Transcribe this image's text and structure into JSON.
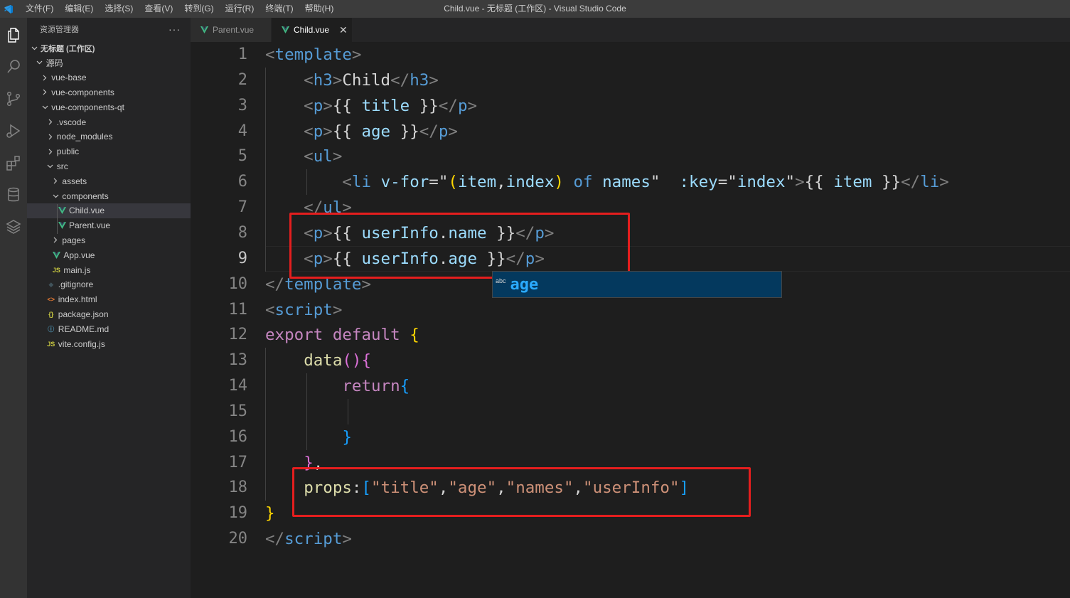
{
  "titlebar": {
    "menu": [
      "文件(F)",
      "编辑(E)",
      "选择(S)",
      "查看(V)",
      "转到(G)",
      "运行(R)",
      "终端(T)",
      "帮助(H)"
    ],
    "window_title": "Child.vue - 无标题 (工作区) - Visual Studio Code"
  },
  "activity_bar": [
    "explorer-icon",
    "search-icon",
    "source-control-icon",
    "run-debug-icon",
    "extensions-icon",
    "database-icon",
    "layers-icon"
  ],
  "sidebar": {
    "title": "资源管理器",
    "more": "···",
    "tree": [
      {
        "label": "无标题 (工作区)",
        "depth": 0,
        "type": "folder-open",
        "bold": true
      },
      {
        "label": "源码",
        "depth": 1,
        "type": "folder-open"
      },
      {
        "label": "vue-base",
        "depth": 2,
        "type": "folder"
      },
      {
        "label": "vue-components",
        "depth": 2,
        "type": "folder"
      },
      {
        "label": "vue-components-qt",
        "depth": 2,
        "type": "folder-open"
      },
      {
        "label": ".vscode",
        "depth": 3,
        "type": "folder"
      },
      {
        "label": "node_modules",
        "depth": 3,
        "type": "folder"
      },
      {
        "label": "public",
        "depth": 3,
        "type": "folder"
      },
      {
        "label": "src",
        "depth": 3,
        "type": "folder-open"
      },
      {
        "label": "assets",
        "depth": 4,
        "type": "folder"
      },
      {
        "label": "components",
        "depth": 4,
        "type": "folder-open"
      },
      {
        "label": "Child.vue",
        "depth": 5,
        "type": "vue",
        "selected": true
      },
      {
        "label": "Parent.vue",
        "depth": 5,
        "type": "vue"
      },
      {
        "label": "pages",
        "depth": 4,
        "type": "folder"
      },
      {
        "label": "App.vue",
        "depth": 4,
        "type": "vue"
      },
      {
        "label": "main.js",
        "depth": 4,
        "type": "js"
      },
      {
        "label": ".gitignore",
        "depth": 3,
        "type": "git"
      },
      {
        "label": "index.html",
        "depth": 3,
        "type": "html"
      },
      {
        "label": "package.json",
        "depth": 3,
        "type": "json"
      },
      {
        "label": "README.md",
        "depth": 3,
        "type": "info"
      },
      {
        "label": "vite.config.js",
        "depth": 3,
        "type": "js"
      }
    ]
  },
  "tabs": [
    {
      "label": "Parent.vue",
      "active": false
    },
    {
      "label": "Child.vue",
      "active": true,
      "close": "✕"
    }
  ],
  "editor": {
    "line_numbers": [
      "1",
      "2",
      "3",
      "4",
      "5",
      "6",
      "7",
      "8",
      "9",
      "10",
      "11",
      "12",
      "13",
      "14",
      "15",
      "16",
      "17",
      "18",
      "19",
      "20"
    ],
    "current_line": 9,
    "lines": [
      [
        [
          "br",
          "<"
        ],
        [
          "tag",
          "template"
        ],
        [
          "br",
          ">"
        ]
      ],
      [
        [
          "br",
          "    <"
        ],
        [
          "tag",
          "h3"
        ],
        [
          "br",
          ">"
        ],
        [
          "txt",
          "Child"
        ],
        [
          "br",
          "</"
        ],
        [
          "tag",
          "h3"
        ],
        [
          "br",
          ">"
        ]
      ],
      [
        [
          "br",
          "    <"
        ],
        [
          "tag",
          "p"
        ],
        [
          "br",
          ">"
        ],
        [
          "txt",
          "{{ "
        ],
        [
          "var",
          "title"
        ],
        [
          "txt",
          " }}"
        ],
        [
          "br",
          "</"
        ],
        [
          "tag",
          "p"
        ],
        [
          "br",
          ">"
        ]
      ],
      [
        [
          "br",
          "    <"
        ],
        [
          "tag",
          "p"
        ],
        [
          "br",
          ">"
        ],
        [
          "txt",
          "{{ "
        ],
        [
          "var",
          "age"
        ],
        [
          "txt",
          " }}"
        ],
        [
          "br",
          "</"
        ],
        [
          "tag",
          "p"
        ],
        [
          "br",
          ">"
        ]
      ],
      [
        [
          "br",
          "    <"
        ],
        [
          "tag",
          "ul"
        ],
        [
          "br",
          ">"
        ]
      ],
      [
        [
          "br",
          "        <"
        ],
        [
          "tag",
          "li"
        ],
        [
          "txt",
          " "
        ],
        [
          "attr",
          "v-for"
        ],
        [
          "txt",
          "=\""
        ],
        [
          "y",
          "("
        ],
        [
          "var",
          "item"
        ],
        [
          "txt",
          ","
        ],
        [
          "var",
          "index"
        ],
        [
          "y",
          ")"
        ],
        [
          "txt",
          " "
        ],
        [
          "tag",
          "of"
        ],
        [
          "txt",
          " "
        ],
        [
          "var",
          "names"
        ],
        [
          "txt",
          "\"  "
        ],
        [
          "attr",
          ":key"
        ],
        [
          "txt",
          "=\""
        ],
        [
          "var",
          "index"
        ],
        [
          "txt",
          "\""
        ],
        [
          "br",
          ">"
        ],
        [
          "txt",
          "{{ "
        ],
        [
          "var",
          "item"
        ],
        [
          "txt",
          " }}"
        ],
        [
          "br",
          "</"
        ],
        [
          "tag",
          "li"
        ],
        [
          "br",
          ">"
        ]
      ],
      [
        [
          "br",
          "    </"
        ],
        [
          "tag",
          "ul"
        ],
        [
          "br",
          ">"
        ]
      ],
      [
        [
          "br",
          "    <"
        ],
        [
          "tag",
          "p"
        ],
        [
          "br",
          ">"
        ],
        [
          "txt",
          "{{ "
        ],
        [
          "var",
          "userInfo"
        ],
        [
          "txt",
          "."
        ],
        [
          "var",
          "name"
        ],
        [
          "txt",
          " }}"
        ],
        [
          "br",
          "</"
        ],
        [
          "tag",
          "p"
        ],
        [
          "br",
          ">"
        ]
      ],
      [
        [
          "br",
          "    <"
        ],
        [
          "tag",
          "p"
        ],
        [
          "br",
          ">"
        ],
        [
          "txt",
          "{{ "
        ],
        [
          "var",
          "userInfo"
        ],
        [
          "txt",
          "."
        ],
        [
          "var",
          "age"
        ],
        [
          "txt",
          " }}"
        ],
        [
          "br",
          "</"
        ],
        [
          "tag",
          "p"
        ],
        [
          "br",
          ">"
        ]
      ],
      [
        [
          "br",
          "</"
        ],
        [
          "tag",
          "template"
        ],
        [
          "br",
          ">"
        ]
      ],
      [
        [
          "br",
          "<"
        ],
        [
          "tag",
          "script"
        ],
        [
          "br",
          ">"
        ]
      ],
      [
        [
          "kw",
          "export"
        ],
        [
          "txt",
          " "
        ],
        [
          "kw",
          "default"
        ],
        [
          "txt",
          " "
        ],
        [
          "y",
          "{"
        ]
      ],
      [
        [
          "txt",
          "    "
        ],
        [
          "fn",
          "data"
        ],
        [
          "pk",
          "()"
        ],
        [
          "pk",
          "{"
        ]
      ],
      [
        [
          "txt",
          "        "
        ],
        [
          "kw",
          "return"
        ],
        [
          "bl",
          "{"
        ]
      ],
      [
        [
          "txt",
          ""
        ]
      ],
      [
        [
          "txt",
          "        "
        ],
        [
          "bl",
          "}"
        ]
      ],
      [
        [
          "txt",
          "    "
        ],
        [
          "pk",
          "}"
        ],
        [
          "txt",
          ","
        ]
      ],
      [
        [
          "txt",
          "    "
        ],
        [
          "fn",
          "props"
        ],
        [
          "txt",
          ":"
        ],
        [
          "bl",
          "["
        ],
        [
          "str",
          "\"title\""
        ],
        [
          "txt",
          ","
        ],
        [
          "str",
          "\"age\""
        ],
        [
          "txt",
          ","
        ],
        [
          "str",
          "\"names\""
        ],
        [
          "txt",
          ","
        ],
        [
          "str",
          "\"userInfo\""
        ],
        [
          "bl",
          "]"
        ]
      ],
      [
        [
          "y",
          "}"
        ]
      ],
      [
        [
          "br",
          "</"
        ],
        [
          "tag",
          "script"
        ],
        [
          "br",
          ">"
        ]
      ]
    ]
  },
  "suggest": {
    "kind_icon": "abc",
    "label": "age"
  },
  "colors": {
    "highlight_box": "#e51e1e",
    "vue_green": "#41b883"
  }
}
